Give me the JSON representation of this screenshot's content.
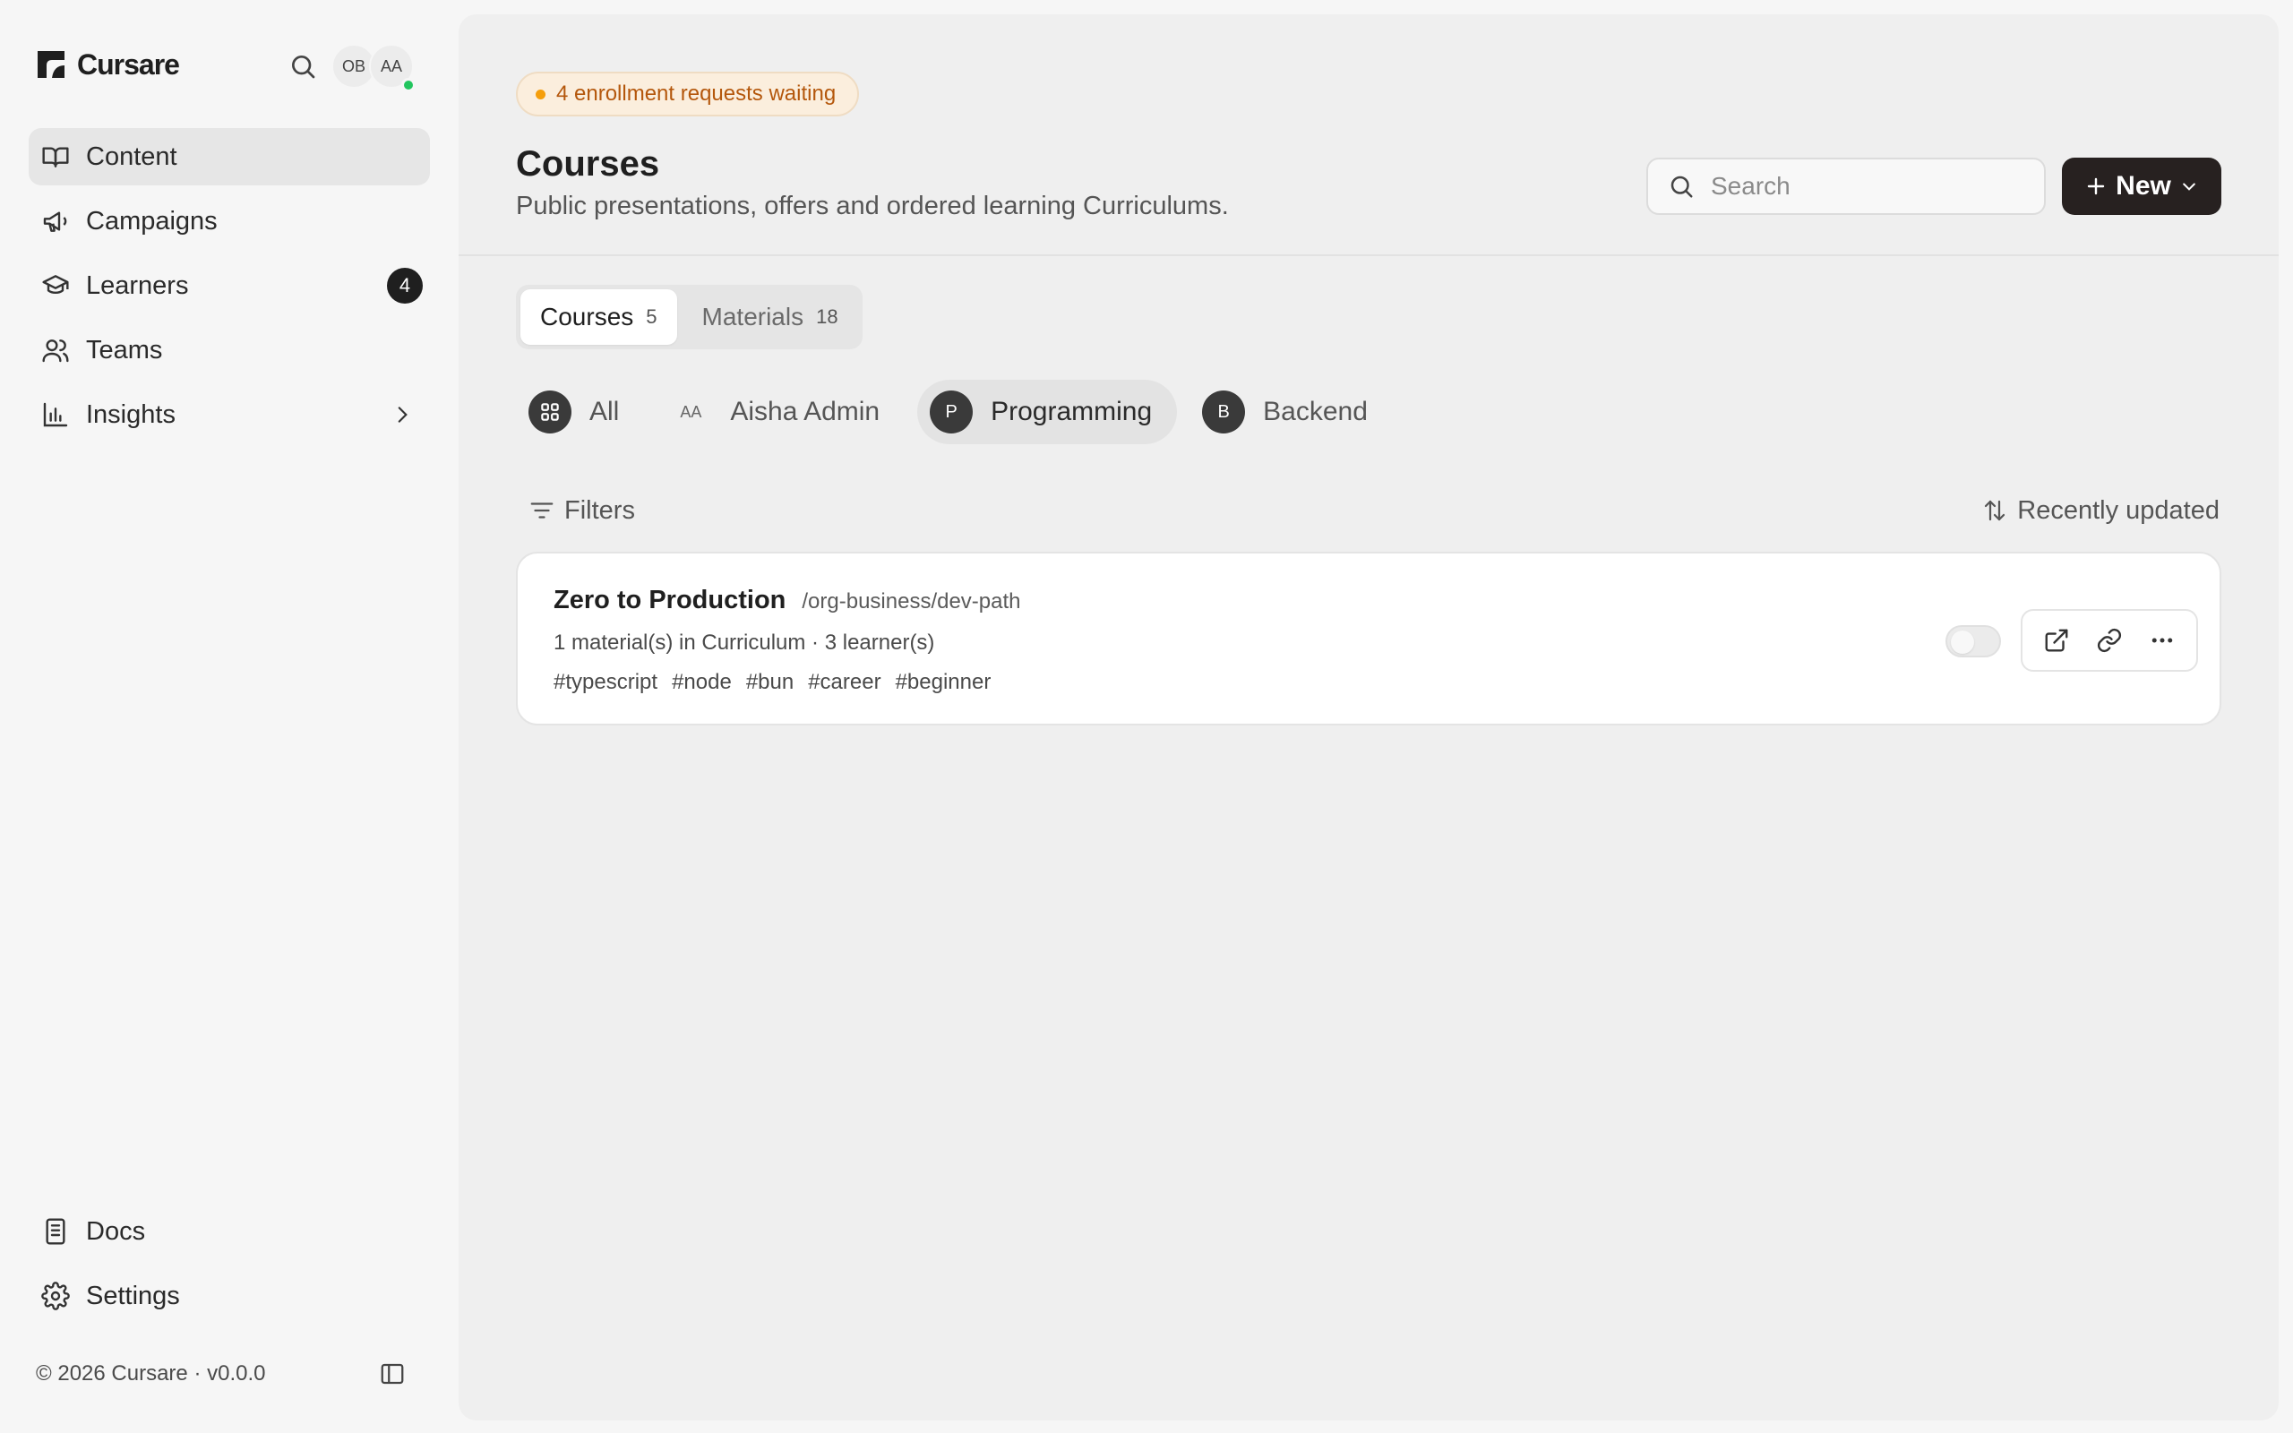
{
  "app": {
    "name": "Cursare"
  },
  "sidebar": {
    "avatars": [
      "OB",
      "AA"
    ],
    "nav": [
      {
        "label": "Content",
        "icon": "book-open-icon",
        "active": true
      },
      {
        "label": "Campaigns",
        "icon": "megaphone-icon"
      },
      {
        "label": "Learners",
        "icon": "graduation-cap-icon",
        "badge": "4"
      },
      {
        "label": "Teams",
        "icon": "users-icon"
      },
      {
        "label": "Insights",
        "icon": "bar-chart-icon"
      }
    ],
    "bottom_nav": [
      {
        "label": "Docs",
        "icon": "document-icon"
      },
      {
        "label": "Settings",
        "icon": "gear-icon"
      }
    ],
    "footer": "© 2026 Cursare · v0.0.0"
  },
  "main": {
    "notice": "4 enrollment requests waiting",
    "title": "Courses",
    "subtitle": "Public presentations, offers and ordered learning Curriculums.",
    "search_placeholder": "Search",
    "new_label": "New",
    "tabs": [
      {
        "label": "Courses",
        "count": "5",
        "active": true
      },
      {
        "label": "Materials",
        "count": "18"
      }
    ],
    "chips": [
      {
        "label": "All",
        "avatar": ""
      },
      {
        "label": "Aisha Admin",
        "avatar": "AA"
      },
      {
        "label": "Programming",
        "avatar": "P",
        "active": true
      },
      {
        "label": "Backend",
        "avatar": "B"
      }
    ],
    "filters_label": "Filters",
    "sort_label": "Recently updated",
    "courses": [
      {
        "name": "Zero to Production",
        "path": "/org-business/dev-path",
        "meta": "1 material(s) in Curriculum · 3 learner(s)",
        "tags": [
          "#typescript",
          "#node",
          "#bun",
          "#career",
          "#beginner"
        ],
        "published": false
      }
    ]
  },
  "colors": {
    "accent_dark": "#272120",
    "notice_text": "#b4570c",
    "notice_bg": "#fbeedd",
    "online": "#22c55e"
  }
}
